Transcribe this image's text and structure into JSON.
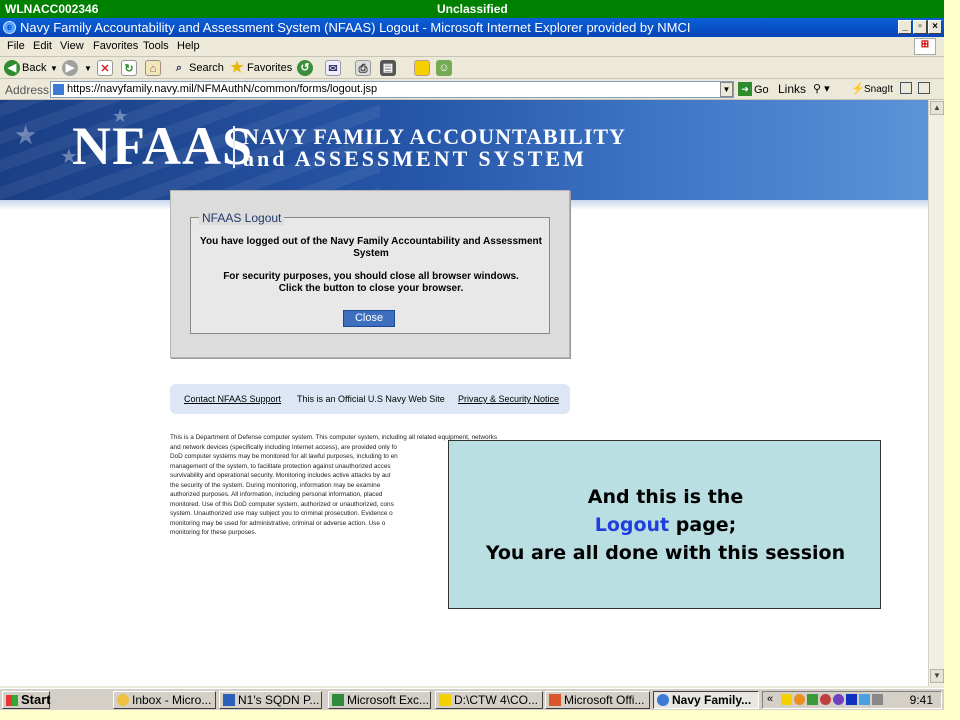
{
  "classification": {
    "host": "WLNACC002346",
    "label": "Unclassified"
  },
  "window": {
    "title": "Navy Family Accountability and Assessment System (NFAAS) Logout - Microsoft Internet Explorer provided by NMCI"
  },
  "menu": [
    "File",
    "Edit",
    "View",
    "Favorites",
    "Tools",
    "Help"
  ],
  "toolbar": {
    "back": "Back",
    "search": "Search",
    "favorites": "Favorites"
  },
  "address": {
    "label": "Address",
    "url": "https://navyfamily.navy.mil/NFMAuthN/common/forms/logout.jsp",
    "go": "Go",
    "links": "Links",
    "snagit": "SnagIt"
  },
  "banner": {
    "logo": "NFAAS",
    "line1": "NAVY FAMILY ACCOUNTABILITY",
    "line2": "and ASSESSMENT SYSTEM"
  },
  "logout": {
    "legend": "NFAAS Logout",
    "message1": "You have logged out of the Navy Family Accountability and Assessment",
    "message1b": "System",
    "message2": "For security purposes, you should close all browser windows.",
    "message3": "Click the button to close your browser.",
    "close_button": "Close"
  },
  "footer": {
    "support_link": "Contact NFAAS Support",
    "official": "This is an Official U.S Navy Web Site",
    "privacy_link": "Privacy & Security Notice"
  },
  "disclaimer": [
    "This is a Department of Defense computer system. This computer system, including all related equipment, networks",
    "and network devices (specifically including Internet access), are provided only fo",
    "DoD computer systems may be monitored for all lawful purposes, including to en",
    "management of the system, to facilitate protection against unauthorized acces",
    "survivability and operational security. Monitoring includes active attacks by aut",
    "the security of the system. During monitoring, information may be examine",
    "authorized purposes. All information, including personal information, placed",
    "monitored. Use of this DoD computer system, authorized or unauthorized, cons",
    "system. Unauthorized use may subject you to criminal prosecution. Evidence o",
    "monitoring may be used for administrative, criminal or adverse action. Use o",
    "monitoring for these purposes."
  ],
  "callout": {
    "line1": "And this is the",
    "line2_highlight": "Logout",
    "line2_rest": " page;",
    "line3": "You are all done with this session"
  },
  "taskbar": {
    "start": "Start",
    "items": [
      "Inbox - Micro...",
      "N1's SQDN P...",
      "Microsoft Exc...",
      "D:\\CTW 4\\CO...",
      "Microsoft Offi...",
      "Navy Family..."
    ],
    "clock": "9:41"
  }
}
